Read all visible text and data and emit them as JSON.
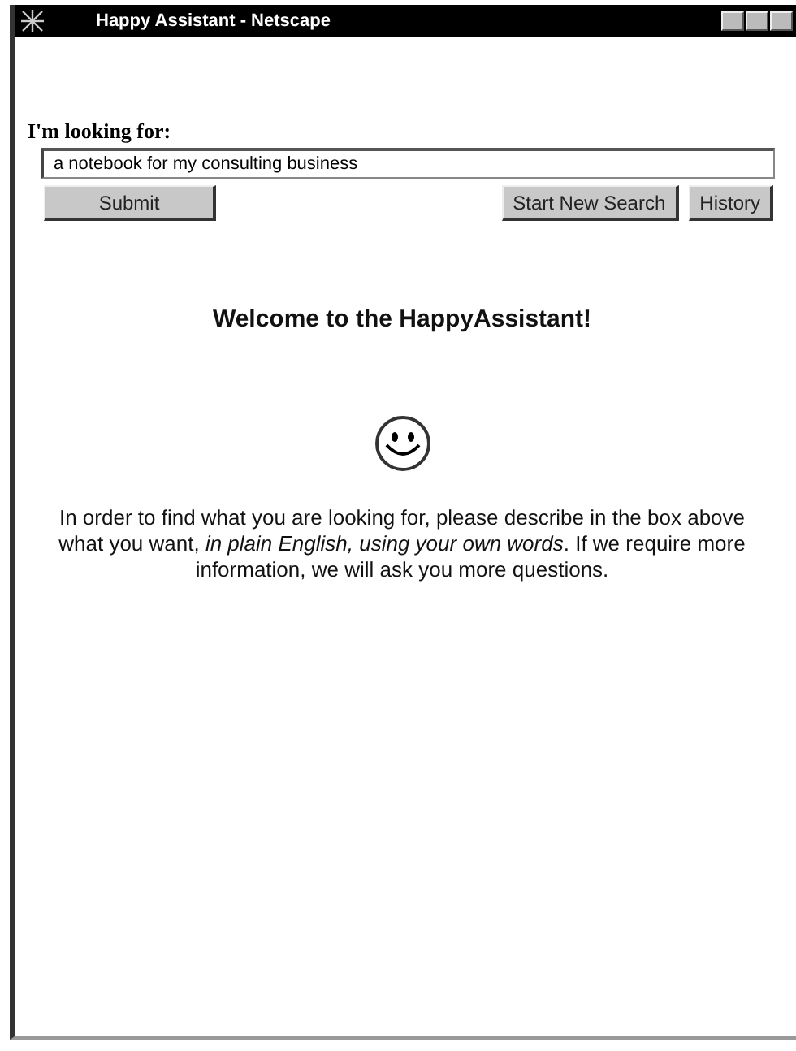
{
  "window": {
    "title": "Happy Assistant - Netscape"
  },
  "form": {
    "label": "I'm looking for:",
    "query": "a notebook for my consulting business",
    "submit_button": "Submit",
    "side_buttons": [
      "Start New Search",
      "History"
    ]
  },
  "welcome": {
    "heading": "Welcome to the HappyAssistant!",
    "message": "In order to find what you are looking for, please describe in the box above what you want, *in plain English, using your own words*. If we require more information, we will ask you more questions."
  }
}
